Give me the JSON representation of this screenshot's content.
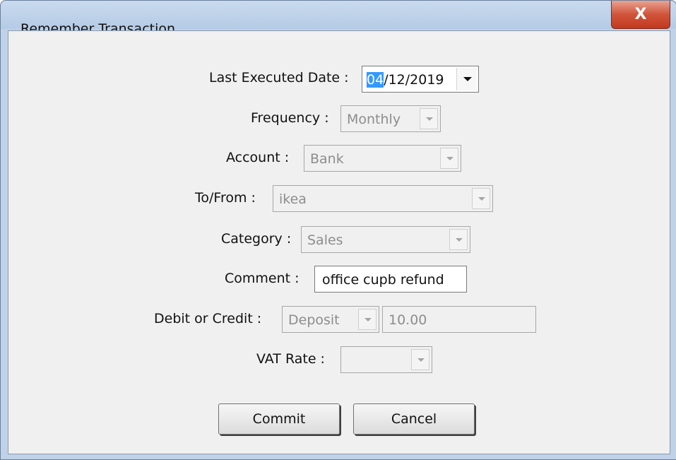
{
  "window": {
    "title": "Remember Transaction",
    "close_glyph": "X"
  },
  "form": {
    "last_executed": {
      "label": "Last Executed Date :",
      "value_selected": "04",
      "value_rest": "/12/2019"
    },
    "frequency": {
      "label": "Frequency :",
      "value": "Monthly"
    },
    "account": {
      "label": "Account :",
      "value": "Bank"
    },
    "to_from": {
      "label": "To/From :",
      "value": "ikea"
    },
    "category": {
      "label": "Category :",
      "value": "Sales"
    },
    "comment": {
      "label": "Comment :",
      "value": "office cupb refund"
    },
    "debit_credit": {
      "label": "Debit or Credit :",
      "type_value": "Deposit",
      "amount": "10.00"
    },
    "vat_rate": {
      "label": "VAT Rate :",
      "value": ""
    }
  },
  "buttons": {
    "commit": "Commit",
    "cancel": "Cancel"
  },
  "colors": {
    "selection": "#3399ff",
    "close_button": "#c23a1f",
    "frame": "#bfd2e8"
  }
}
